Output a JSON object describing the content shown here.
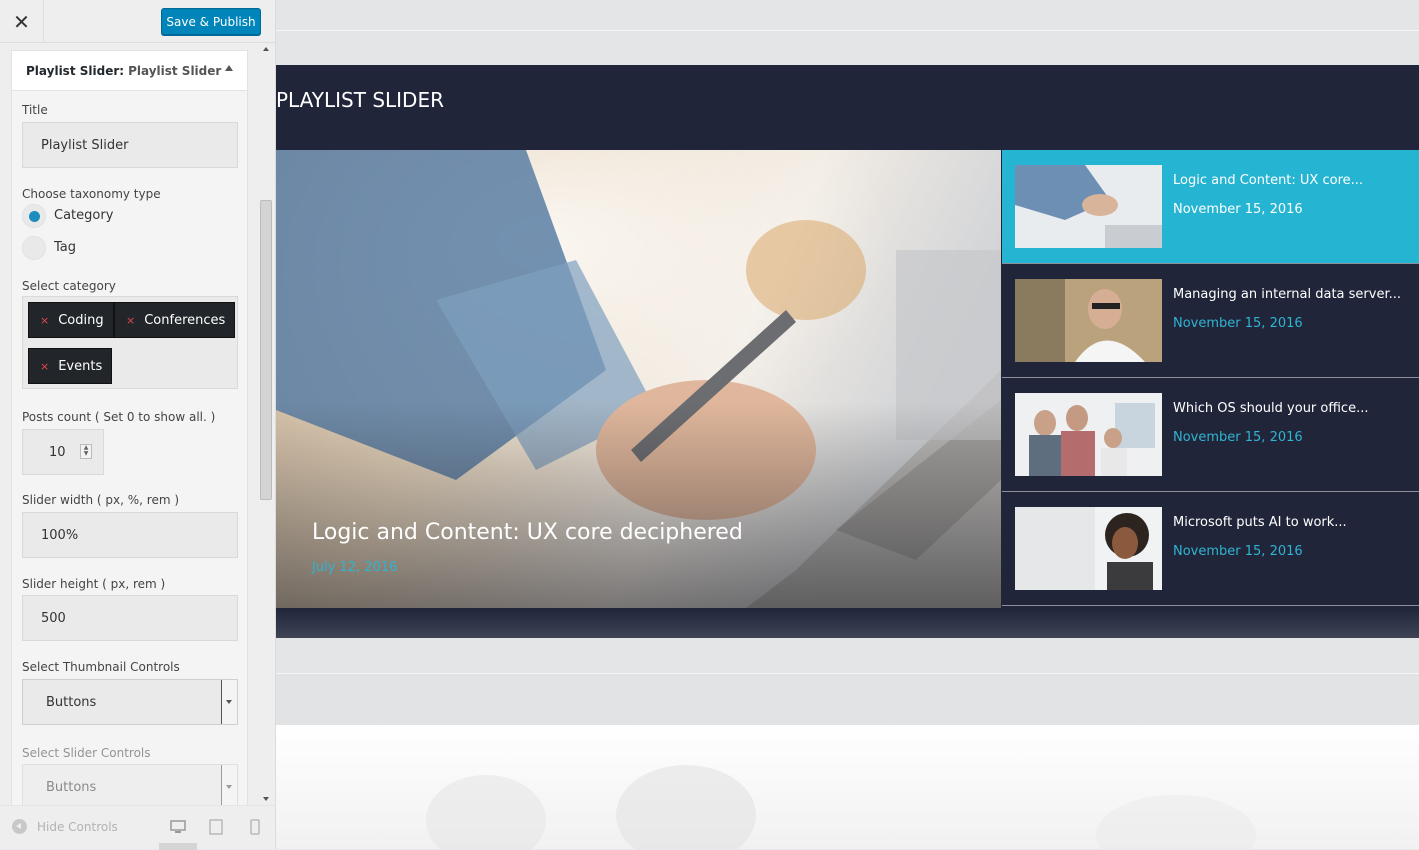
{
  "header": {
    "close_label": "✕",
    "publish_label": "Save & Publish"
  },
  "widget": {
    "head_prefix": "Playlist Slider:",
    "head_name": "Playlist Slider",
    "title_label": "Title",
    "title_value": "Playlist Slider",
    "taxonomy_label": "Choose taxonomy type",
    "taxonomy_options": [
      {
        "label": "Category",
        "selected": true
      },
      {
        "label": "Tag",
        "selected": false
      }
    ],
    "category_label": "Select category",
    "categories": [
      {
        "remove": "×",
        "label": "Coding"
      },
      {
        "remove": "×",
        "label": "Conferences"
      },
      {
        "remove": "×",
        "label": "Events"
      }
    ],
    "posts_count_label": "Posts count ( Set 0 to show all. )",
    "posts_count_value": "10",
    "slider_width_label": "Slider width ( px, %, rem )",
    "slider_width_value": "100%",
    "slider_height_label": "Slider height ( px, rem )",
    "slider_height_value": "500",
    "thumb_controls_label": "Select Thumbnail Controls",
    "thumb_controls_value": "Buttons",
    "slider_controls_label": "Select Slider Controls",
    "slider_controls_value": "Buttons"
  },
  "footer": {
    "hide_controls_label": "Hide Controls",
    "device_icons": [
      "desktop-icon",
      "tablet-icon",
      "mobile-icon"
    ]
  },
  "preview": {
    "section_title": "PLAYLIST SLIDER",
    "hero": {
      "title": "Logic and Content: UX core deciphered",
      "date": "July 12, 2016"
    },
    "playlist": [
      {
        "title": "Logic and Content: UX core...",
        "date": "November 15, 2016",
        "active": true
      },
      {
        "title": "Managing an internal data server...",
        "date": "November 15, 2016",
        "active": false
      },
      {
        "title": "Which OS should your office...",
        "date": "November 15, 2016",
        "active": false
      },
      {
        "title": "Microsoft puts AI to work...",
        "date": "November 15, 2016",
        "active": false
      }
    ]
  },
  "colors": {
    "accent": "#25b5d2",
    "publish": "#0085ba",
    "dark_bg": "#21253a",
    "chip_bg": "#22262b",
    "chip_remove": "#e2494b"
  }
}
